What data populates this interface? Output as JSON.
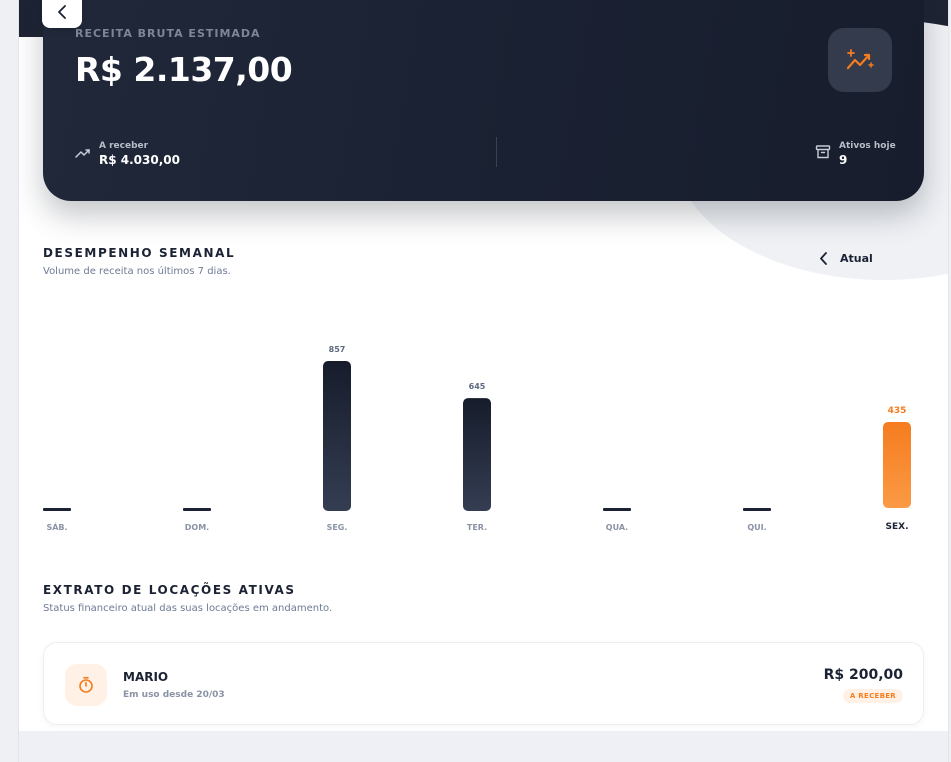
{
  "hero": {
    "label": "RECEITA BRUTA ESTIMADA",
    "value": "R$ 2.137,00",
    "icon": "sparkle-trend-icon",
    "stats": [
      {
        "label": "A receber",
        "value": "R$ 4.030,00",
        "icon": "trend-up-icon"
      },
      {
        "label": "Ativos hoje",
        "value": "9",
        "icon": "archive-icon"
      }
    ]
  },
  "weekly": {
    "title": "DESEMPENHO SEMANAL",
    "subtitle": "Volume de receita nos últimos 7 dias.",
    "period_label": "Atual"
  },
  "chart_data": {
    "type": "bar",
    "categories": [
      "SÁB.",
      "DOM.",
      "SEG.",
      "TER.",
      "QUA.",
      "QUI.",
      "SEX."
    ],
    "values": [
      0,
      0,
      857,
      645,
      0,
      0,
      435
    ],
    "value_labels": [
      "",
      "",
      "857",
      "645",
      "",
      "",
      "435"
    ],
    "highlight_index": 6,
    "colors": {
      "default": "#1b2233",
      "highlight": "#f57c1f"
    },
    "title": "",
    "xlabel": "",
    "ylabel": "",
    "grid": false
  },
  "rentals": {
    "title": "EXTRATO DE LOCAÇÕES ATIVAS",
    "subtitle": "Status financeiro atual das suas locações em andamento.",
    "items": [
      {
        "name": "MARIO",
        "since": "Em uso desde 20/03",
        "amount": "R$ 200,00",
        "status": "A RECEBER",
        "icon": "stopwatch-icon"
      }
    ]
  },
  "colors": {
    "dark": "#1b2233",
    "accent": "#f57c1f",
    "muted": "#6d7b94"
  }
}
